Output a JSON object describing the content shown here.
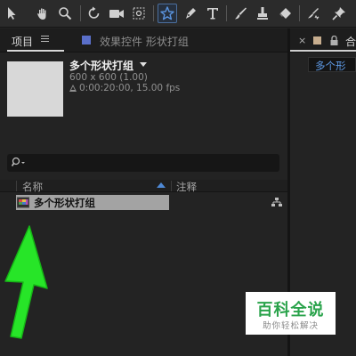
{
  "toolbar": {
    "tools": [
      "selection-tool",
      "hand-tool",
      "zoom-tool",
      "rotation-tool",
      "camera-tool",
      "pan-behind-tool",
      "star-shape-tool",
      "pen-tool",
      "type-tool",
      "brush-tool",
      "clone-stamp-tool",
      "eraser-tool",
      "roto-brush-tool",
      "puppet-pin-tool"
    ],
    "active_tool": "star-shape-tool",
    "active_color": "#4e89d6"
  },
  "project_panel": {
    "tab_label": "项目",
    "effects_tab_label": "效果控件 形状打组",
    "effects_tab_color": "#5a6fc9",
    "comp_name": "多个形状打组",
    "comp_size": "600 x 600 (1.00)",
    "comp_duration": "0:00:20:00, 15.00 fps",
    "search": {
      "placeholder": "",
      "icon": "search-icon"
    },
    "columns": {
      "name": "名称",
      "comment": "注释"
    },
    "items": [
      {
        "name": "多个形状打组",
        "selected": true
      }
    ]
  },
  "right_panel": {
    "tab_label": "合",
    "tab_color": "#c7ad8e",
    "comp_tab_label": "多个形",
    "comp_tab_color": "#5e9ae6"
  },
  "annotation": {
    "arrow_color": "#27e528"
  },
  "watermark": {
    "title": "百科全说",
    "subtitle": "助你轻松解决",
    "color": "#2aa34b"
  }
}
